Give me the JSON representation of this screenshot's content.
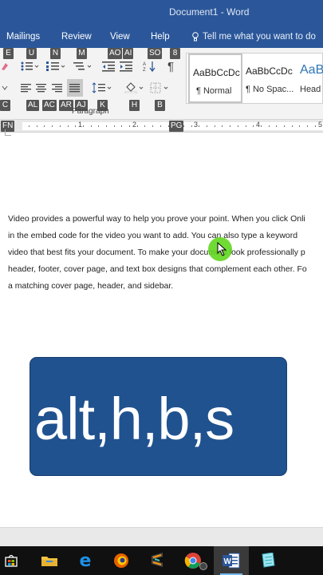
{
  "window": {
    "title": "Document1 - Word"
  },
  "ribbon_tabs": [
    {
      "label": "Mailings"
    },
    {
      "label": "Review"
    },
    {
      "label": "View"
    },
    {
      "label": "Help"
    }
  ],
  "tell_me": {
    "placeholder": "Tell me what you want to do"
  },
  "keytips": {
    "row1": [
      "E",
      "U",
      "N",
      "M",
      "AO",
      "AI",
      "SO",
      "8"
    ],
    "row2": [
      "C",
      "AL",
      "AC",
      "AR",
      "AJ",
      "K",
      "H",
      "B"
    ],
    "ruler": [
      "FN",
      "PG"
    ]
  },
  "paragraph_group": {
    "label": "Paragraph"
  },
  "styles": [
    {
      "sample": "AaBbCcDc",
      "name": "¶ Normal",
      "selected": true
    },
    {
      "sample": "AaBbCcDc",
      "name": "¶ No Spac...",
      "selected": false
    },
    {
      "sample": "AaB",
      "name": "Head",
      "selected": false
    }
  ],
  "ruler": {
    "numbers": [
      "1",
      "2",
      "3",
      "4",
      "5"
    ]
  },
  "document": {
    "lines": [
      "Video provides a powerful way to help you prove your point. When you click Onli",
      "in the embed code for the video you want to add. You can also type a keyword",
      "video that best fits your document. To make your document look professionally p",
      "header, footer, cover page, and text box designs that complement each other. Fo",
      "a matching cover page, header, and sidebar."
    ]
  },
  "overlay": {
    "shortcut": "alt,h,b,s",
    "box_color": "#20528f"
  },
  "colors": {
    "word_blue": "#2b579a",
    "cursor_highlight": "#62d71f"
  },
  "taskbar": {
    "icons": [
      "windows-store-icon",
      "file-explorer-icon",
      "edge-icon",
      "firefox-icon",
      "sublime-icon",
      "chrome-icon",
      "word-icon",
      "notepad-icon"
    ],
    "active": "word-icon"
  }
}
